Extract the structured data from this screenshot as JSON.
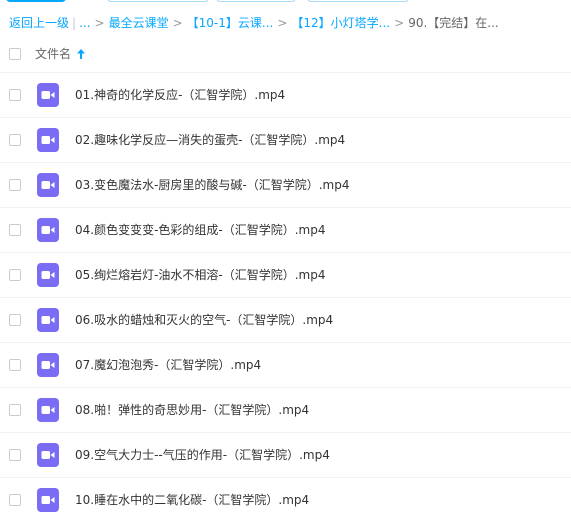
{
  "breadcrumb": {
    "back_label": "返回上一级",
    "ellipsis": "...",
    "items": [
      {
        "label": "最全云课堂"
      },
      {
        "label": "【10-1】云课..."
      },
      {
        "label": "【12】小灯塔学..."
      },
      {
        "label": "90.【完结】在..."
      }
    ]
  },
  "table": {
    "name_header": "文件名"
  },
  "files": [
    {
      "name": "01.神奇的化学反应-（汇智学院）.mp4",
      "icon": "video-file-icon"
    },
    {
      "name": "02.趣味化学反应—消失的蛋壳-（汇智学院）.mp4",
      "icon": "video-file-icon"
    },
    {
      "name": "03.变色魔法水-厨房里的酸与碱-（汇智学院）.mp4",
      "icon": "video-file-icon"
    },
    {
      "name": "04.颜色变变变-色彩的组成-（汇智学院）.mp4",
      "icon": "video-file-icon"
    },
    {
      "name": "05.绚烂熔岩灯-油水不相溶-（汇智学院）.mp4",
      "icon": "video-file-icon"
    },
    {
      "name": "06.吸水的蜡烛和灭火的空气-（汇智学院）.mp4",
      "icon": "video-file-icon"
    },
    {
      "name": "07.魔幻泡泡秀-（汇智学院）.mp4",
      "icon": "video-file-icon"
    },
    {
      "name": "08.啪！弹性的奇思妙用-（汇智学院）.mp4",
      "icon": "video-file-icon"
    },
    {
      "name": "09.空气大力士--气压的作用-（汇智学院）.mp4",
      "icon": "video-file-icon"
    },
    {
      "name": "10.睡在水中的二氧化碳-（汇智学院）.mp4",
      "icon": "video-file-icon"
    }
  ],
  "colors": {
    "accent": "#06a7ff",
    "video_icon": "#7b6cf6"
  }
}
